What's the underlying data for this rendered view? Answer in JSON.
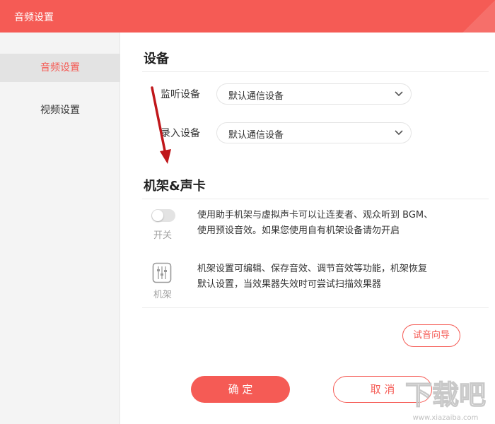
{
  "window": {
    "title": "音频设置"
  },
  "sidebar": {
    "items": [
      {
        "label": "音频设置",
        "active": true
      },
      {
        "label": "视频设置",
        "active": false
      }
    ]
  },
  "device": {
    "title": "设备",
    "monitor_label": "监听设备",
    "monitor_value": "默认通信设备",
    "record_label": "录入设备",
    "record_value": "默认通信设备"
  },
  "rack": {
    "title": "机架&声卡",
    "switch_caption": "开关",
    "switch_on": false,
    "switch_desc_line1": "使用助手机架与虚拟声卡可以让连麦者、观众听到 BGM、",
    "switch_desc_line2": "使用预设音效。如果您使用自有机架设备请勿开启",
    "rack_caption": "机架",
    "rack_desc_line1": "机架设置可编辑、保存音效、调节音效等功能，机架恢复",
    "rack_desc_line2": "默认设置，当效果器失效时可尝试扫描效果器",
    "test_button": "试音向导"
  },
  "footer": {
    "ok": "确 定",
    "cancel": "取 消"
  },
  "watermark": {
    "text": "下载吧",
    "url": "www.xiazaiba.com"
  },
  "icons": [
    "chevron-down-icon",
    "rack-icon",
    "red-arrow-annotation"
  ],
  "colors": {
    "accent": "#f55b55",
    "sidebar_bg": "#f4f4f4",
    "sidebar_active_bg": "#e3e3e3",
    "toggle_off": "#e3e3e3"
  }
}
